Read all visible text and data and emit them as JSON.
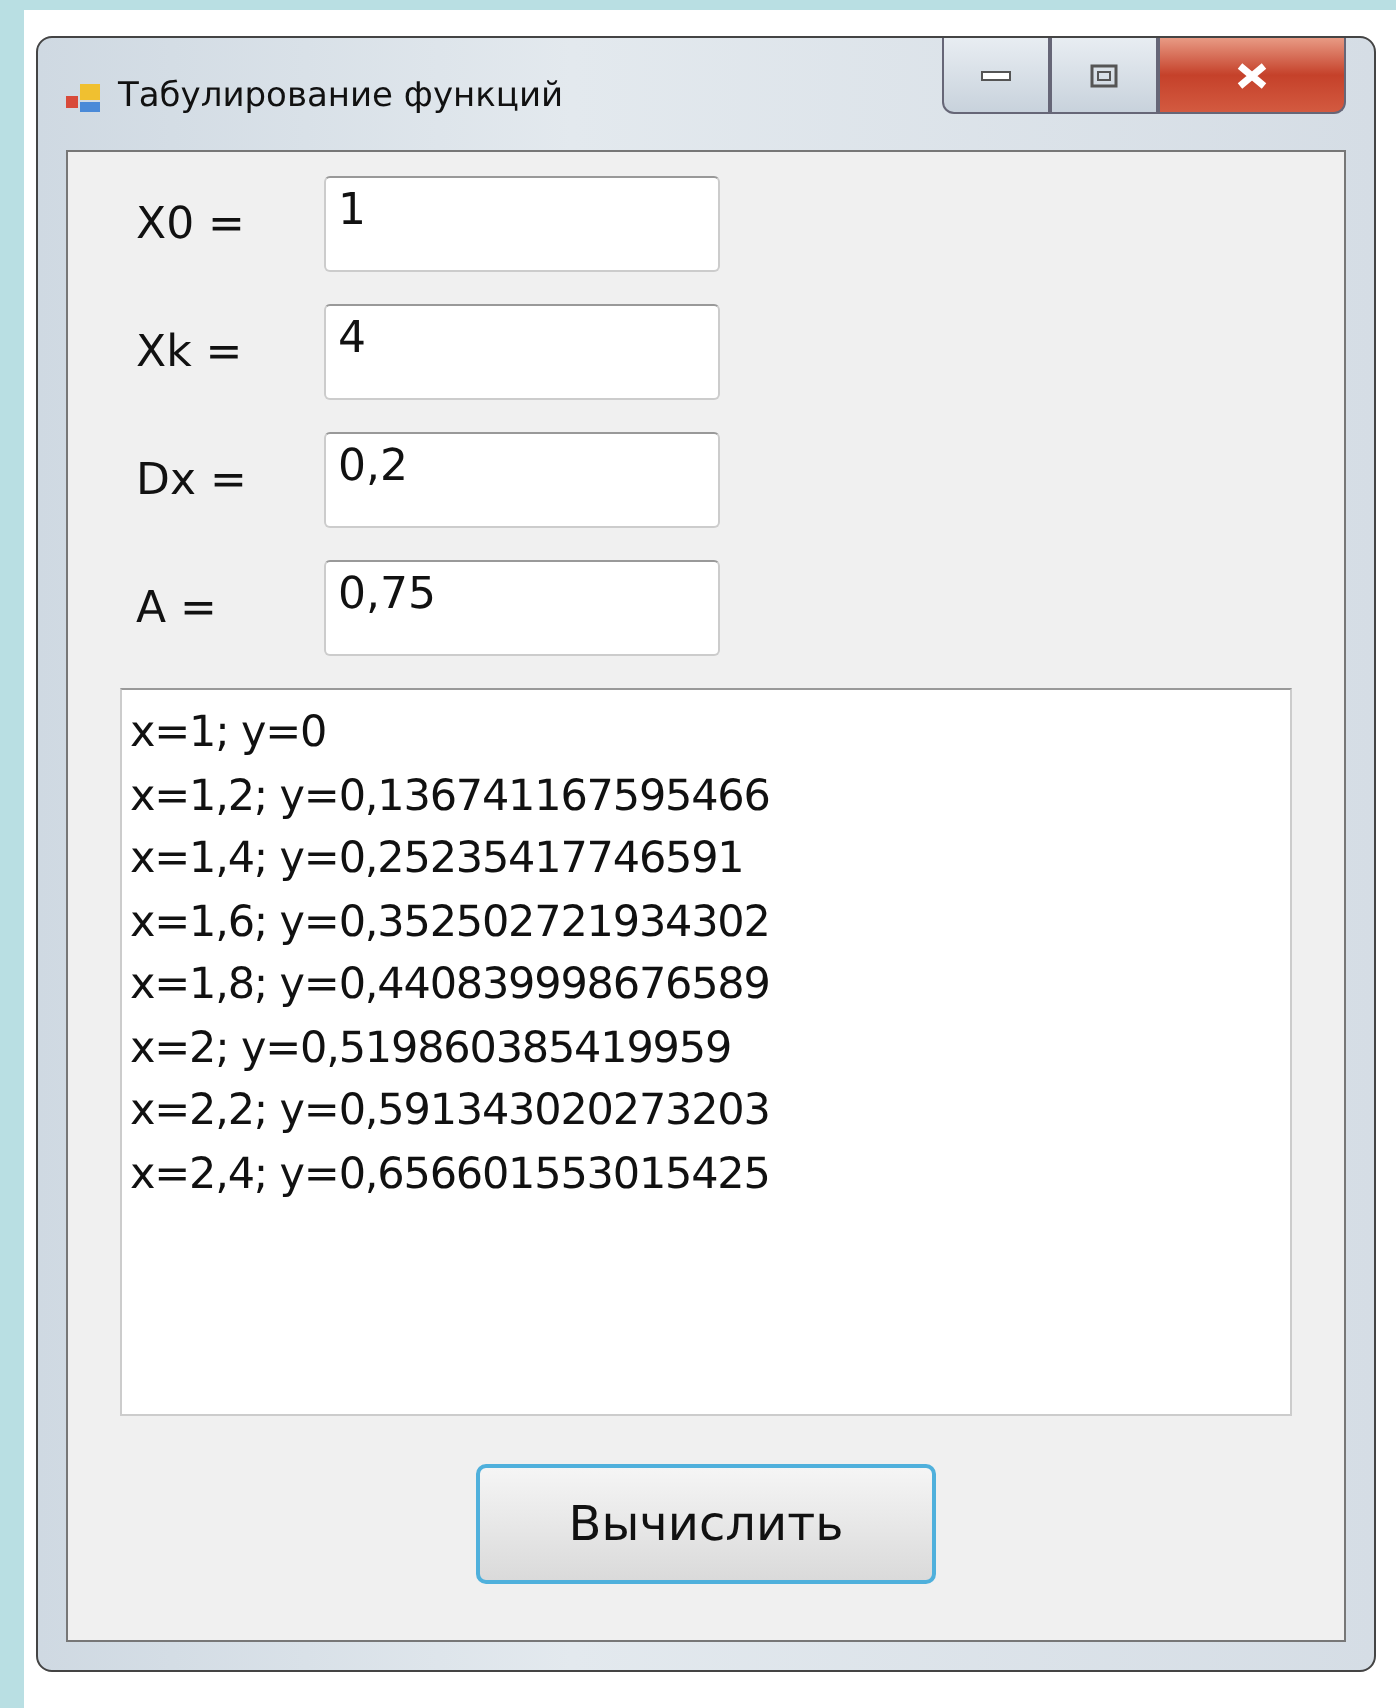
{
  "window": {
    "title": "Табулирование функций"
  },
  "fields": [
    {
      "label": "X0 =",
      "value": "1"
    },
    {
      "label": "Xk =",
      "value": "4"
    },
    {
      "label": "Dx =",
      "value": "0,2"
    },
    {
      "label": "A =",
      "value": "0,75"
    }
  ],
  "output": {
    "lines": [
      "x=1; y=0",
      "x=1,2; y=0,136741167595466",
      "x=1,4; y=0,25235417746591",
      "x=1,6; y=0,352502721934302",
      "x=1,8; y=0,440839998676589",
      "x=2; y=0,519860385419959",
      "x=2,2; y=0,591343020273203",
      "x=2,4; y=0,656601553015425"
    ]
  },
  "buttons": [
    "Вычислить"
  ]
}
